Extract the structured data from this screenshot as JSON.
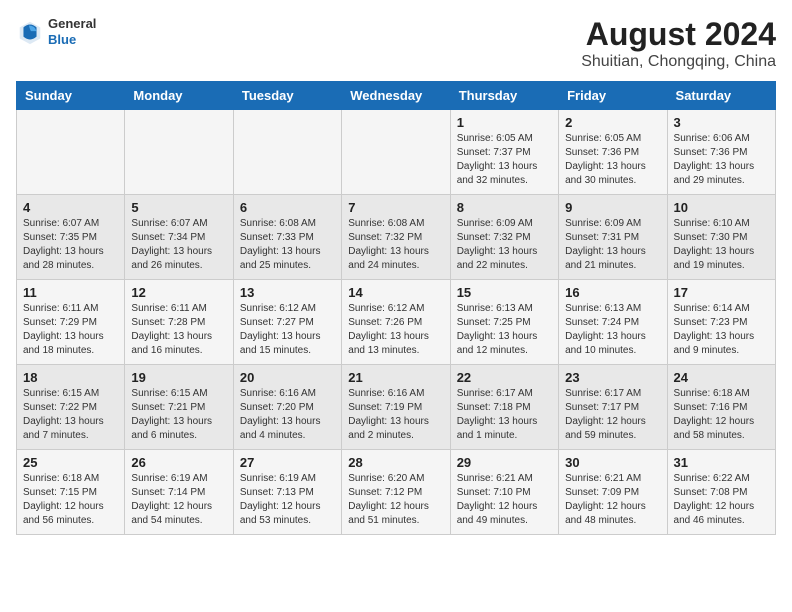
{
  "header": {
    "title": "August 2024",
    "subtitle": "Shuitian, Chongqing, China",
    "logo_general": "General",
    "logo_blue": "Blue"
  },
  "days_of_week": [
    "Sunday",
    "Monday",
    "Tuesday",
    "Wednesday",
    "Thursday",
    "Friday",
    "Saturday"
  ],
  "weeks": [
    [
      {
        "day": "",
        "info": ""
      },
      {
        "day": "",
        "info": ""
      },
      {
        "day": "",
        "info": ""
      },
      {
        "day": "",
        "info": ""
      },
      {
        "day": "1",
        "info": "Sunrise: 6:05 AM\nSunset: 7:37 PM\nDaylight: 13 hours\nand 32 minutes."
      },
      {
        "day": "2",
        "info": "Sunrise: 6:05 AM\nSunset: 7:36 PM\nDaylight: 13 hours\nand 30 minutes."
      },
      {
        "day": "3",
        "info": "Sunrise: 6:06 AM\nSunset: 7:36 PM\nDaylight: 13 hours\nand 29 minutes."
      }
    ],
    [
      {
        "day": "4",
        "info": "Sunrise: 6:07 AM\nSunset: 7:35 PM\nDaylight: 13 hours\nand 28 minutes."
      },
      {
        "day": "5",
        "info": "Sunrise: 6:07 AM\nSunset: 7:34 PM\nDaylight: 13 hours\nand 26 minutes."
      },
      {
        "day": "6",
        "info": "Sunrise: 6:08 AM\nSunset: 7:33 PM\nDaylight: 13 hours\nand 25 minutes."
      },
      {
        "day": "7",
        "info": "Sunrise: 6:08 AM\nSunset: 7:32 PM\nDaylight: 13 hours\nand 24 minutes."
      },
      {
        "day": "8",
        "info": "Sunrise: 6:09 AM\nSunset: 7:32 PM\nDaylight: 13 hours\nand 22 minutes."
      },
      {
        "day": "9",
        "info": "Sunrise: 6:09 AM\nSunset: 7:31 PM\nDaylight: 13 hours\nand 21 minutes."
      },
      {
        "day": "10",
        "info": "Sunrise: 6:10 AM\nSunset: 7:30 PM\nDaylight: 13 hours\nand 19 minutes."
      }
    ],
    [
      {
        "day": "11",
        "info": "Sunrise: 6:11 AM\nSunset: 7:29 PM\nDaylight: 13 hours\nand 18 minutes."
      },
      {
        "day": "12",
        "info": "Sunrise: 6:11 AM\nSunset: 7:28 PM\nDaylight: 13 hours\nand 16 minutes."
      },
      {
        "day": "13",
        "info": "Sunrise: 6:12 AM\nSunset: 7:27 PM\nDaylight: 13 hours\nand 15 minutes."
      },
      {
        "day": "14",
        "info": "Sunrise: 6:12 AM\nSunset: 7:26 PM\nDaylight: 13 hours\nand 13 minutes."
      },
      {
        "day": "15",
        "info": "Sunrise: 6:13 AM\nSunset: 7:25 PM\nDaylight: 13 hours\nand 12 minutes."
      },
      {
        "day": "16",
        "info": "Sunrise: 6:13 AM\nSunset: 7:24 PM\nDaylight: 13 hours\nand 10 minutes."
      },
      {
        "day": "17",
        "info": "Sunrise: 6:14 AM\nSunset: 7:23 PM\nDaylight: 13 hours\nand 9 minutes."
      }
    ],
    [
      {
        "day": "18",
        "info": "Sunrise: 6:15 AM\nSunset: 7:22 PM\nDaylight: 13 hours\nand 7 minutes."
      },
      {
        "day": "19",
        "info": "Sunrise: 6:15 AM\nSunset: 7:21 PM\nDaylight: 13 hours\nand 6 minutes."
      },
      {
        "day": "20",
        "info": "Sunrise: 6:16 AM\nSunset: 7:20 PM\nDaylight: 13 hours\nand 4 minutes."
      },
      {
        "day": "21",
        "info": "Sunrise: 6:16 AM\nSunset: 7:19 PM\nDaylight: 13 hours\nand 2 minutes."
      },
      {
        "day": "22",
        "info": "Sunrise: 6:17 AM\nSunset: 7:18 PM\nDaylight: 13 hours\nand 1 minute."
      },
      {
        "day": "23",
        "info": "Sunrise: 6:17 AM\nSunset: 7:17 PM\nDaylight: 12 hours\nand 59 minutes."
      },
      {
        "day": "24",
        "info": "Sunrise: 6:18 AM\nSunset: 7:16 PM\nDaylight: 12 hours\nand 58 minutes."
      }
    ],
    [
      {
        "day": "25",
        "info": "Sunrise: 6:18 AM\nSunset: 7:15 PM\nDaylight: 12 hours\nand 56 minutes."
      },
      {
        "day": "26",
        "info": "Sunrise: 6:19 AM\nSunset: 7:14 PM\nDaylight: 12 hours\nand 54 minutes."
      },
      {
        "day": "27",
        "info": "Sunrise: 6:19 AM\nSunset: 7:13 PM\nDaylight: 12 hours\nand 53 minutes."
      },
      {
        "day": "28",
        "info": "Sunrise: 6:20 AM\nSunset: 7:12 PM\nDaylight: 12 hours\nand 51 minutes."
      },
      {
        "day": "29",
        "info": "Sunrise: 6:21 AM\nSunset: 7:10 PM\nDaylight: 12 hours\nand 49 minutes."
      },
      {
        "day": "30",
        "info": "Sunrise: 6:21 AM\nSunset: 7:09 PM\nDaylight: 12 hours\nand 48 minutes."
      },
      {
        "day": "31",
        "info": "Sunrise: 6:22 AM\nSunset: 7:08 PM\nDaylight: 12 hours\nand 46 minutes."
      }
    ]
  ]
}
